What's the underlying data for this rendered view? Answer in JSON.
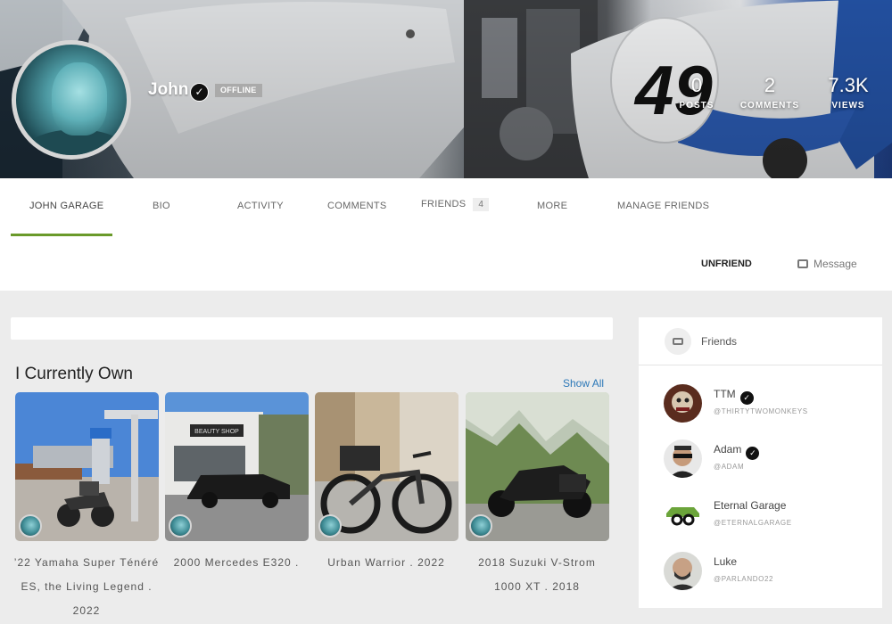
{
  "profile": {
    "name": "John",
    "status_badge": "OFFLINE",
    "stats": [
      {
        "value": "0",
        "label": "POSTS"
      },
      {
        "value": "2",
        "label": "COMMENTS"
      },
      {
        "value": "7.3K",
        "label": "VIEWS"
      }
    ],
    "cover_number": "49"
  },
  "tabs": [
    {
      "label": "JOHN GARAGE",
      "active": true
    },
    {
      "label": "BIO"
    },
    {
      "label": "ACTIVITY"
    },
    {
      "label": "COMMENTS"
    },
    {
      "label": "FRIENDS",
      "count": "4"
    },
    {
      "label": "MORE"
    },
    {
      "label": "MANAGE FRIENDS"
    }
  ],
  "actions": {
    "unfriend": "UNFRIEND",
    "message": "Message"
  },
  "garage": {
    "title": "I Currently Own",
    "show_all": "Show All",
    "vehicles": [
      {
        "caption_lines": [
          "’22 Yamaha Super Ténéré",
          "ES, the Living Legend .",
          "2022"
        ],
        "sign": ""
      },
      {
        "caption_lines": [
          "2000 Mercedes E320 ."
        ],
        "sign": "BEAUTY SHOP"
      },
      {
        "caption_lines": [
          "Urban Warrior . 2022"
        ],
        "sign": ""
      },
      {
        "caption_lines": [
          "2018 Suzuki V-Strom",
          "1000 XT . 2018"
        ],
        "sign": ""
      }
    ]
  },
  "friends_panel": {
    "title": "Friends",
    "friends": [
      {
        "name": "TTM",
        "handle": "@THIRTYTWOMONKEYS",
        "verified": true
      },
      {
        "name": "Adam",
        "handle": "@ADAM",
        "verified": true
      },
      {
        "name": "Eternal Garage",
        "handle": "@ETERNALGARAGE",
        "verified": false
      },
      {
        "name": "Luke",
        "handle": "@PARLANDO22",
        "verified": false
      }
    ]
  }
}
